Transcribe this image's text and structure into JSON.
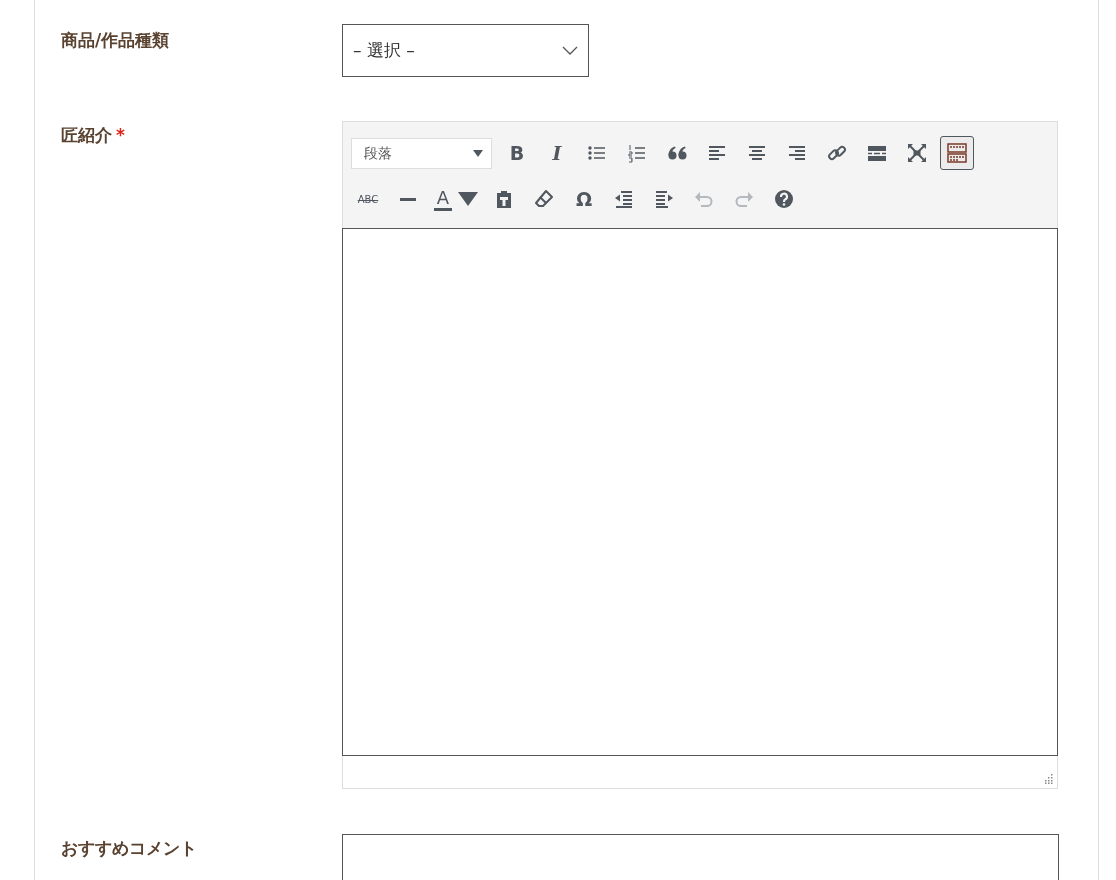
{
  "required_mark": "*",
  "fields": [
    {
      "kind": "select",
      "label": "商品/作品種類",
      "required": false,
      "value": "– 選択 –"
    },
    {
      "kind": "editor",
      "label": "匠紹介",
      "required": true,
      "format": "段落",
      "toolbar_rows": [
        [
          {
            "kind": "bold",
            "label": "B",
            "pressed": false,
            "disabled": false
          },
          {
            "kind": "italic",
            "label": "I",
            "pressed": false,
            "disabled": false
          },
          {
            "kind": "bullist",
            "pressed": false,
            "disabled": false
          },
          {
            "kind": "numlist",
            "pressed": false,
            "disabled": false
          },
          {
            "kind": "blockquote",
            "pressed": false,
            "disabled": false
          },
          {
            "kind": "alignleft",
            "pressed": false,
            "disabled": false
          },
          {
            "kind": "aligncenter",
            "pressed": false,
            "disabled": false
          },
          {
            "kind": "alignright",
            "pressed": false,
            "disabled": false
          },
          {
            "kind": "link",
            "pressed": false,
            "disabled": false
          },
          {
            "kind": "more",
            "pressed": false,
            "disabled": false
          },
          {
            "kind": "fullscreen",
            "pressed": false,
            "disabled": false
          },
          {
            "kind": "toolbar",
            "pressed": true,
            "disabled": false
          }
        ],
        [
          {
            "kind": "strike",
            "label": "ABC",
            "pressed": false,
            "disabled": false
          },
          {
            "kind": "hr",
            "pressed": false,
            "disabled": false
          },
          {
            "kind": "forecolor",
            "label": "A",
            "pressed": false,
            "disabled": false
          },
          {
            "kind": "pastetext",
            "pressed": false,
            "disabled": false
          },
          {
            "kind": "eraser",
            "pressed": false,
            "disabled": false
          },
          {
            "kind": "charmap",
            "label": "Ω",
            "pressed": false,
            "disabled": false
          },
          {
            "kind": "outdent",
            "pressed": false,
            "disabled": false
          },
          {
            "kind": "indent",
            "pressed": false,
            "disabled": false
          },
          {
            "kind": "undo",
            "pressed": false,
            "disabled": true
          },
          {
            "kind": "redo",
            "pressed": false,
            "disabled": true
          },
          {
            "kind": "help",
            "pressed": false,
            "disabled": false
          }
        ]
      ]
    },
    {
      "kind": "textarea",
      "label": "おすすめコメント",
      "required": false
    }
  ]
}
